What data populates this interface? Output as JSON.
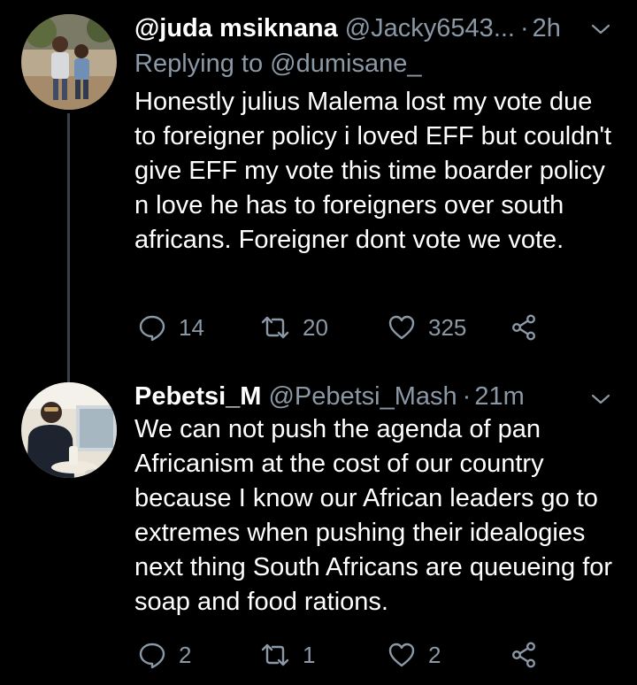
{
  "tweets": [
    {
      "display_name": "@juda msiknana",
      "handle": "@Jacky6543...",
      "separator": "·",
      "time": "2h",
      "replying_to": "Replying to @dumisane_",
      "text": "Honestly julius Malema lost my vote due to foreigner policy i loved EFF but couldn't give EFF my vote this time boarder policy n love he has to foreigners over south africans. Foreigner dont vote we vote.",
      "actions": {
        "replies": "14",
        "retweets": "20",
        "likes": "325"
      }
    },
    {
      "display_name": "Pebetsi_M",
      "handle": "@Pebetsi_Mash",
      "separator": "·",
      "time": "21m",
      "text": "We can not push the agenda of pan Africanism at the cost of our country because I know our African leaders go to extremes when pushing their idealogies next thing South Africans are queueing for soap and food rations.",
      "actions": {
        "replies": "2",
        "retweets": "1",
        "likes": "2"
      }
    }
  ],
  "icons": {
    "reply": "speech-bubble-icon",
    "retweet": "retweet-arrows-icon",
    "like": "heart-icon",
    "share": "share-nodes-icon",
    "more": "chevron-down-icon"
  },
  "colors": {
    "background": "#000000",
    "primary_text": "#ffffff",
    "secondary_text": "#8b98a5",
    "thread_line": "#3a4047"
  }
}
